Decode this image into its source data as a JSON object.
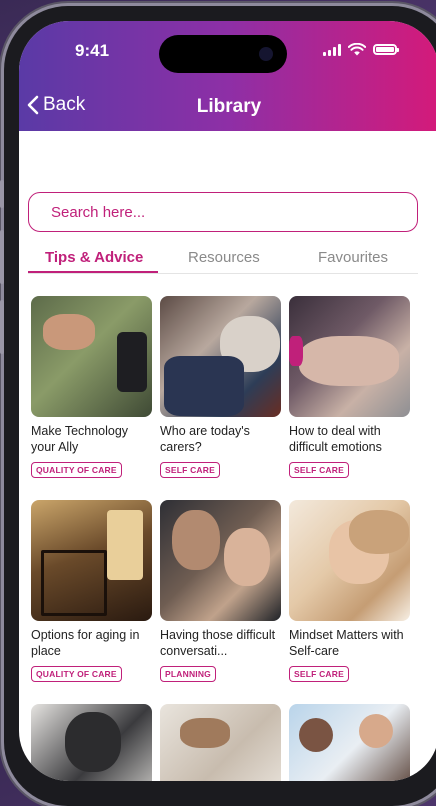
{
  "status": {
    "time": "9:41"
  },
  "header": {
    "back_label": "Back",
    "title": "Library"
  },
  "search": {
    "placeholder": "Search here..."
  },
  "tabs": [
    "Tips & Advice",
    "Resources",
    "Favourites"
  ],
  "articles": [
    {
      "title": "Make Technology your Ally",
      "tag": "QUALITY OF CARE"
    },
    {
      "title": "Who are today's carers?",
      "tag": "SELF CARE"
    },
    {
      "title": "How to deal with difficult emotions",
      "tag": "SELF CARE"
    },
    {
      "title": "Options for aging in place",
      "tag": "QUALITY OF CARE"
    },
    {
      "title": "Having those difficult conversati...",
      "tag": "PLANNING"
    },
    {
      "title": "Mindset Matters with Self-care",
      "tag": "SELF CARE"
    },
    {
      "title": "",
      "tag": ""
    },
    {
      "title": "",
      "tag": ""
    },
    {
      "title": "",
      "tag": ""
    }
  ],
  "colors": {
    "accent": "#c0207a",
    "header_start": "#5a3aa6",
    "header_end": "#d41a7a"
  }
}
